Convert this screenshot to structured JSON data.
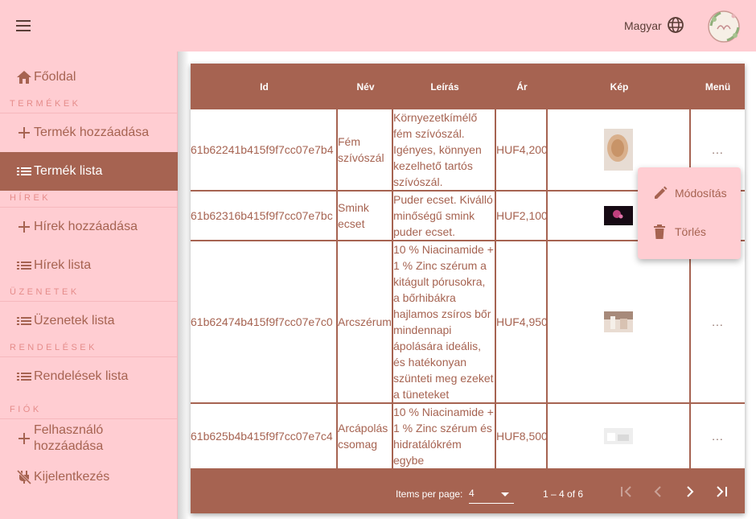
{
  "header": {
    "language_label": "Magyar",
    "icons": {
      "menu": "menu-icon",
      "language": "globe-icon",
      "avatar": "logo-avatar"
    }
  },
  "sidebar": {
    "home": {
      "label": "Főoldal",
      "icon": "home-icon"
    },
    "sections": [
      {
        "title": "TERMÉKEK",
        "items": [
          {
            "label": "Termék hozzáadása",
            "icon": "plus-icon"
          },
          {
            "label": "Termék lista",
            "icon": "list-icon",
            "active": true
          }
        ]
      },
      {
        "title": "HÍREK",
        "items": [
          {
            "label": "Hírek hozzáadása",
            "icon": "plus-icon"
          },
          {
            "label": "Hírek lista",
            "icon": "list-icon"
          }
        ]
      },
      {
        "title": "ÜZENETEK",
        "items": [
          {
            "label": "Üzenetek lista",
            "icon": "list-icon"
          }
        ]
      },
      {
        "title": "RENDELÉSEK",
        "items": [
          {
            "label": "Rendelések lista",
            "icon": "list-icon"
          }
        ]
      },
      {
        "title": "FIÓK",
        "items": [
          {
            "label_line1": "Felhasználó",
            "label_line2": "hozzáadása",
            "icon": "plus-icon"
          },
          {
            "label": "Kijelentkezés",
            "icon": "no-power-icon"
          }
        ]
      }
    ]
  },
  "table": {
    "columns": [
      "Id",
      "Név",
      "Leírás",
      "Ár",
      "Kép",
      "Menü"
    ],
    "rows": [
      {
        "id": "61b62241b415f9f7cc07e7b4",
        "name_lines": [
          "Fém",
          "szívószál"
        ],
        "desc_lines": [
          "Környezetkímélő",
          "fém szívószál.",
          "Igényes, könnyen",
          "kezelhető tartós",
          "szívószál."
        ],
        "price": "HUF4,200",
        "menu": "..."
      },
      {
        "id": "61b62316b415f9f7cc07e7bc",
        "name_lines": [
          "Smink",
          "ecset"
        ],
        "desc_lines": [
          "Puder ecset. Kiválló",
          "minőségű smink",
          "puder ecset."
        ],
        "price": "HUF2,100",
        "menu": "..."
      },
      {
        "id": "61b62474b415f9f7cc07e7c0",
        "name_lines": [
          "Arcszérum"
        ],
        "desc_lines": [
          "10 % Niacinamide +",
          "1 % Zinc szérum a",
          "kitágult pórusokra,",
          "a bőrhibákra",
          "hajlamos zsíros bőr",
          "mindennapi",
          "ápolására ideális,",
          "és hatékonyan",
          "szünteti meg ezeket",
          "a tüneteket"
        ],
        "price": "HUF4,950",
        "menu": "..."
      },
      {
        "id": "61b625b4b415f9f7cc07e7c4",
        "name_lines": [
          "Arcápolás",
          "csomag"
        ],
        "desc_lines": [
          "10 % Niacinamide +",
          "1 % Zinc szérum és",
          "hidratálókrém",
          "egybe"
        ],
        "price": "HUF8,500",
        "menu": "..."
      }
    ]
  },
  "paginator": {
    "items_per_page_label": "Items per page:",
    "items_per_page_value": "4",
    "range_label": "1 – 4 of 6",
    "icons": [
      "first-page-icon",
      "prev-page-icon",
      "next-page-icon",
      "last-page-icon"
    ]
  },
  "context_menu": {
    "edit_label": "Módosítás",
    "delete_label": "Törlés",
    "icons": {
      "edit": "pencil-icon",
      "delete": "trash-icon"
    }
  },
  "colors": {
    "primary": "#a66351",
    "pink": "#ffcdd2",
    "section_label": "#e58c8a"
  }
}
